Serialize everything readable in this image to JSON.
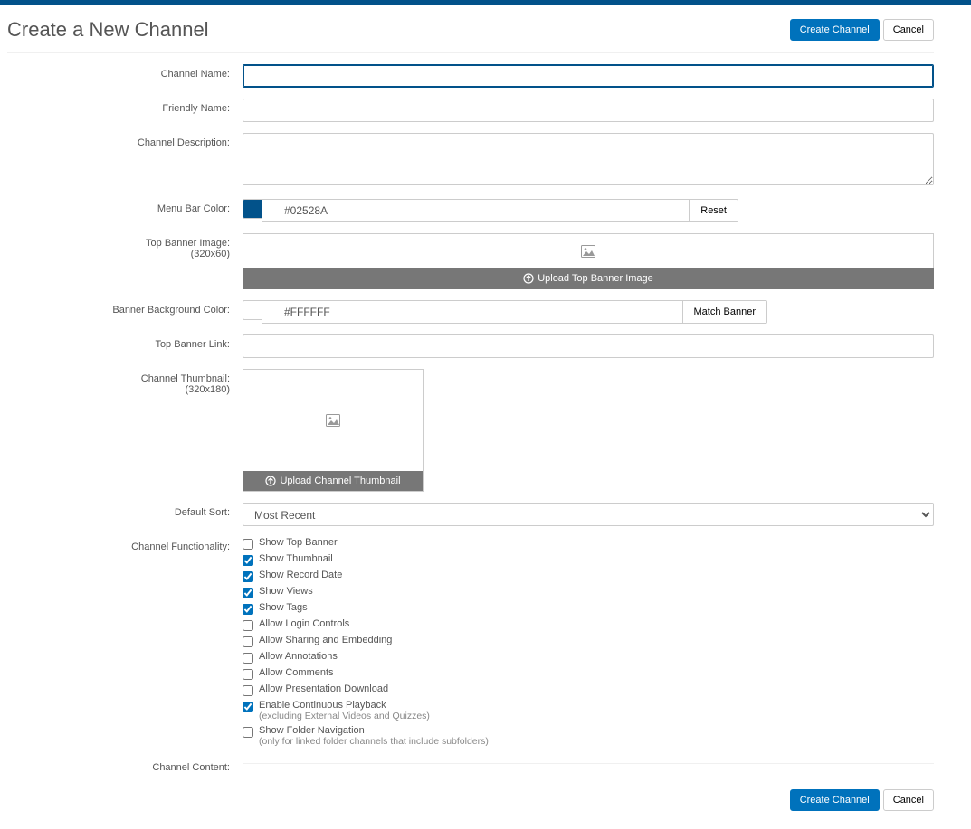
{
  "page": {
    "title": "Create a New Channel"
  },
  "buttons": {
    "create": "Create Channel",
    "cancel": "Cancel",
    "reset": "Reset",
    "matchBanner": "Match Banner",
    "uploadBanner": "Upload Top Banner Image",
    "uploadThumbnail": "Upload Channel Thumbnail"
  },
  "labels": {
    "channelName": "Channel Name:",
    "friendlyName": "Friendly Name:",
    "channelDescription": "Channel Description:",
    "menuBarColor": "Menu Bar Color:",
    "topBannerImage": "Top Banner Image:",
    "topBannerImageSub": "(320x60)",
    "bannerBgColor": "Banner Background Color:",
    "topBannerLink": "Top Banner Link:",
    "channelThumbnail": "Channel Thumbnail:",
    "channelThumbnailSub": "(320x180)",
    "defaultSort": "Default Sort:",
    "channelFunctionality": "Channel Functionality:",
    "channelContent": "Channel Content:"
  },
  "values": {
    "channelName": "",
    "friendlyName": "",
    "channelDescription": "",
    "menuBarColor": "#02528A",
    "bannerBgColor": "#FFFFFF",
    "topBannerLink": "",
    "defaultSort": "Most Recent"
  },
  "colors": {
    "menuBarSwatch": "#02528A",
    "bannerBgSwatch": "#FFFFFF"
  },
  "sortOptions": [
    "Most Recent"
  ],
  "functionality": [
    {
      "label": "Show Top Banner",
      "checked": false
    },
    {
      "label": "Show Thumbnail",
      "checked": true
    },
    {
      "label": "Show Record Date",
      "checked": true
    },
    {
      "label": "Show Views",
      "checked": true
    },
    {
      "label": "Show Tags",
      "checked": true
    },
    {
      "label": "Allow Login Controls",
      "checked": false
    },
    {
      "label": "Allow Sharing and Embedding",
      "checked": false
    },
    {
      "label": "Allow Annotations",
      "checked": false
    },
    {
      "label": "Allow Comments",
      "checked": false
    },
    {
      "label": "Allow Presentation Download",
      "checked": false
    },
    {
      "label": "Enable Continuous Playback",
      "sub": "(excluding External Videos and Quizzes)",
      "checked": true
    },
    {
      "label": "Show Folder Navigation",
      "sub": "(only for linked folder channels that include subfolders)",
      "checked": false
    }
  ]
}
